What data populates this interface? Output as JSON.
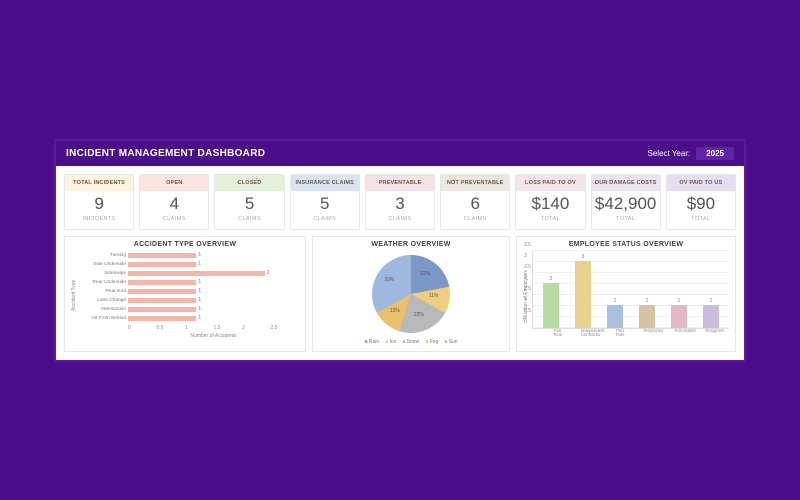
{
  "header": {
    "title": "INCIDENT MANAGEMENT DASHBOARD",
    "year_label": "Select Year:",
    "year_value": "2025"
  },
  "kpis": [
    {
      "label": "TOTAL INCIDENTS",
      "value": "9",
      "sub": "INCIDENTS",
      "cls": "c0"
    },
    {
      "label": "OPEN",
      "value": "4",
      "sub": "CLAIMS",
      "cls": "c1"
    },
    {
      "label": "CLOSED",
      "value": "5",
      "sub": "CLAIMS",
      "cls": "c2"
    },
    {
      "label": "INSURANCE CLAIMS",
      "value": "5",
      "sub": "CLAIMS",
      "cls": "c3"
    },
    {
      "label": "PREVENTABLE",
      "value": "3",
      "sub": "CLAIMS",
      "cls": "c4"
    },
    {
      "label": "NOT PREVENTABLE",
      "value": "6",
      "sub": "CLAIMS",
      "cls": "c5"
    },
    {
      "label": "LOSS PAID TO OV",
      "value": "$140",
      "sub": "TOTAL",
      "cls": "c6"
    },
    {
      "label": "OUR DAMAGE COSTS",
      "value": "$42,900",
      "sub": "TOTAL",
      "cls": "c7"
    },
    {
      "label": "OV PAID TO US",
      "value": "$90",
      "sub": "TOTAL",
      "cls": "c8"
    }
  ],
  "chart_data": [
    {
      "type": "bar",
      "orientation": "horizontal",
      "title": "ACCIDENT TYPE OVERVIEW",
      "xlabel": "Number of Accidents",
      "ylabel": "Accident Type",
      "xlim": [
        0,
        2.5
      ],
      "xticks": [
        0,
        0.5,
        1,
        1.5,
        2,
        2.5
      ],
      "categories": [
        "Turning",
        "Side Underside",
        "Sideswipe",
        "Rear Underside",
        "Rear-End",
        "Lane Change",
        "Intersection",
        "Hit From Behind"
      ],
      "values": [
        1,
        1,
        2,
        1,
        1,
        1,
        1,
        1
      ]
    },
    {
      "type": "pie",
      "title": "WEATHER OVERVIEW",
      "series": [
        {
          "name": "Rain",
          "value": 22,
          "color": "#7b98c7"
        },
        {
          "name": "Ice",
          "value": 11,
          "color": "#efcf7e"
        },
        {
          "name": "Snow",
          "value": 22,
          "color": "#b9b9b9"
        },
        {
          "name": "Fog",
          "value": 12,
          "color": "#e9c06b"
        },
        {
          "name": "Sun",
          "value": 33,
          "color": "#9fb9de"
        }
      ]
    },
    {
      "type": "bar",
      "orientation": "vertical",
      "title": "EMPLOYEE STATUS OVERVIEW",
      "ylabel": "Number of Employees",
      "ylim": [
        0,
        3.5
      ],
      "yticks": [
        0,
        0.5,
        1,
        1.5,
        2,
        2.5,
        3,
        3.5
      ],
      "categories": [
        "Full Time",
        "Independent Contractor",
        "Part Time",
        "Temporary",
        "Terminated",
        "Resigned"
      ],
      "values": [
        2,
        3,
        1,
        1,
        1,
        1
      ]
    }
  ]
}
